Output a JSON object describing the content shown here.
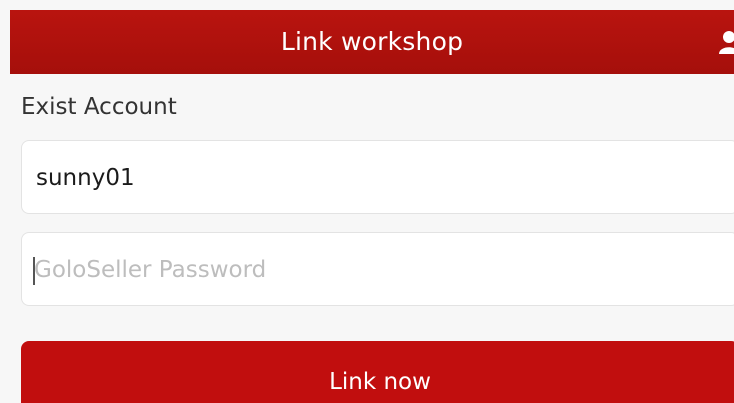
{
  "header": {
    "title": "Link workshop",
    "user_icon": "user-icon"
  },
  "form": {
    "section_label": "Exist Account",
    "account_value": "sunny01",
    "password_placeholder": "GoloSeller Password",
    "submit_label": "Link now"
  },
  "colors": {
    "header_red": "#a50f0b",
    "button_red": "#c10e0e",
    "background": "#f7f7f7"
  }
}
